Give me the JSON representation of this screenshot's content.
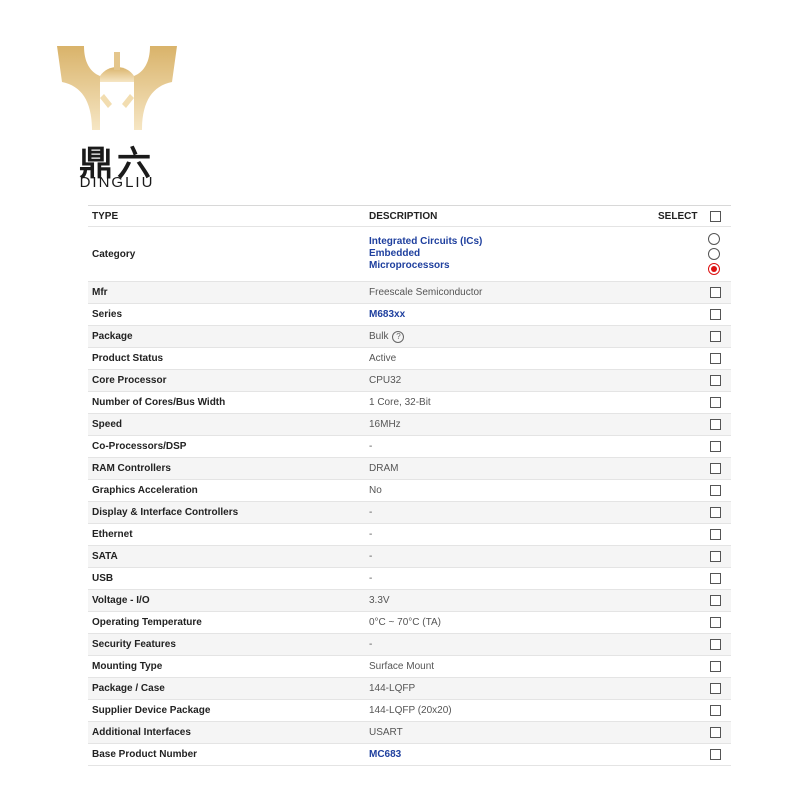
{
  "logo": {
    "chinese": "鼎六",
    "english": "DINGLIU"
  },
  "table": {
    "header": {
      "type": "TYPE",
      "description": "DESCRIPTION",
      "select": "SELECT"
    },
    "category": {
      "label": "Category",
      "values": [
        "Integrated Circuits (ICs)",
        "Embedded",
        "Microprocessors"
      ],
      "selected_index": 2
    },
    "rows": [
      {
        "type": "Mfr",
        "description": "Freescale Semiconductor"
      },
      {
        "type": "Series",
        "description": "M683xx",
        "link": true
      },
      {
        "type": "Package",
        "description": "Bulk",
        "help": true
      },
      {
        "type": "Product Status",
        "description": "Active"
      },
      {
        "type": "Core Processor",
        "description": "CPU32"
      },
      {
        "type": "Number of Cores/Bus Width",
        "description": "1 Core, 32-Bit"
      },
      {
        "type": "Speed",
        "description": "16MHz"
      },
      {
        "type": "Co-Processors/DSP",
        "description": "-"
      },
      {
        "type": "RAM Controllers",
        "description": "DRAM"
      },
      {
        "type": "Graphics Acceleration",
        "description": "No"
      },
      {
        "type": "Display & Interface Controllers",
        "description": "-"
      },
      {
        "type": "Ethernet",
        "description": "-"
      },
      {
        "type": "SATA",
        "description": "-"
      },
      {
        "type": "USB",
        "description": "-"
      },
      {
        "type": "Voltage - I/O",
        "description": "3.3V"
      },
      {
        "type": "Operating Temperature",
        "description": "0°C ~ 70°C (TA)"
      },
      {
        "type": "Security Features",
        "description": "-"
      },
      {
        "type": "Mounting Type",
        "description": "Surface Mount"
      },
      {
        "type": "Package / Case",
        "description": "144-LQFP"
      },
      {
        "type": "Supplier Device Package",
        "description": "144-LQFP (20x20)"
      },
      {
        "type": "Additional Interfaces",
        "description": "USART"
      },
      {
        "type": "Base Product Number",
        "description": "MC683",
        "link": true
      }
    ]
  }
}
